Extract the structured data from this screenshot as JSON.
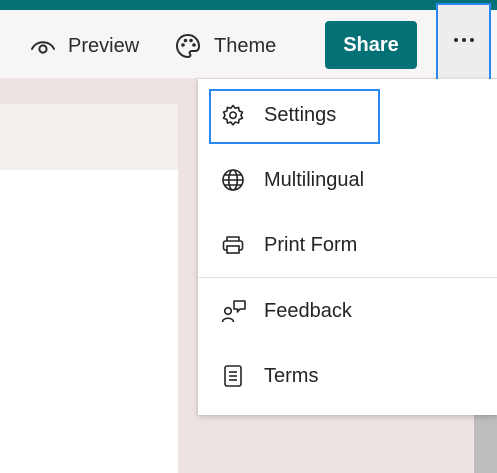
{
  "toolbar": {
    "preview_label": "Preview",
    "theme_label": "Theme",
    "share_label": "Share",
    "more_icon": "more-horizontal-icon"
  },
  "menu": {
    "items": [
      {
        "label": "Settings",
        "icon": "gear-icon"
      },
      {
        "label": "Multilingual",
        "icon": "globe-icon"
      },
      {
        "label": "Print Form",
        "icon": "printer-icon"
      },
      {
        "label": "Feedback",
        "icon": "feedback-icon"
      },
      {
        "label": "Terms",
        "icon": "document-icon"
      }
    ]
  },
  "colors": {
    "brand_teal": "#047176",
    "focus_blue": "#2b88f0",
    "background": "#ede3e1"
  }
}
